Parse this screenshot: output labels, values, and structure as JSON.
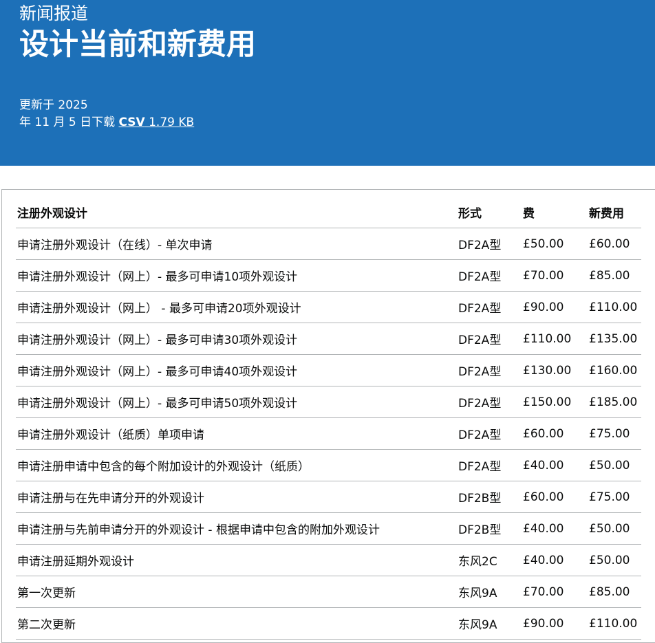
{
  "header": {
    "caption": "新闻报道",
    "title": "设计当前和新费用",
    "updated": "更新于 2025",
    "download_prefix": "年 11 月 5 日下载",
    "csv_label": "CSV",
    "csv_size": "1.79 KB"
  },
  "table": {
    "columns": [
      "注册外观设计",
      "形式",
      "费",
      "新费用"
    ],
    "rows": [
      [
        "申请注册外观设计（在线）- 单次申请",
        "DF2A型",
        "£50.00",
        "£60.00"
      ],
      [
        "申请注册外观设计（网上）- 最多可申请10项外观设计",
        "DF2A型",
        "£70.00",
        "£85.00"
      ],
      [
        "申请注册外观设计（网上） - 最多可申请20项外观设计",
        "DF2A型",
        "£90.00",
        "£110.00"
      ],
      [
        "申请注册外观设计（网上）- 最多可申请30项外观设计",
        "DF2A型",
        "£110.00",
        "£135.00"
      ],
      [
        "申请注册外观设计（网上）- 最多可申请40项外观设计",
        "DF2A型",
        "£130.00",
        "£160.00"
      ],
      [
        "申请注册外观设计（网上）- 最多可申请50项外观设计",
        "DF2A型",
        "£150.00",
        "£185.00"
      ],
      [
        "申请注册外观设计（纸质）单项申请",
        "DF2A型",
        "£60.00",
        "£75.00"
      ],
      [
        "申请注册申请中包含的每个附加设计的外观设计（纸质）",
        "DF2A型",
        "£40.00",
        "£50.00"
      ],
      [
        "申请注册与在先申请分开的外观设计",
        "DF2B型",
        "£60.00",
        "£75.00"
      ],
      [
        "申请注册与先前申请分开的外观设计 - 根据申请中包含的附加外观设计",
        "DF2B型",
        "£40.00",
        "£50.00"
      ],
      [
        "申请注册延期外观设计",
        "东风2C",
        "£40.00",
        "£50.00"
      ],
      [
        "第一次更新",
        "东风9A",
        "£70.00",
        "£85.00"
      ],
      [
        "第二次更新",
        "东风9A",
        "£90.00",
        "£110.00"
      ]
    ]
  },
  "colors": {
    "header_bg": "#1d70b8",
    "header_text": "#ffffff",
    "border": "#b1b4b6",
    "text": "#0b0c0c"
  }
}
